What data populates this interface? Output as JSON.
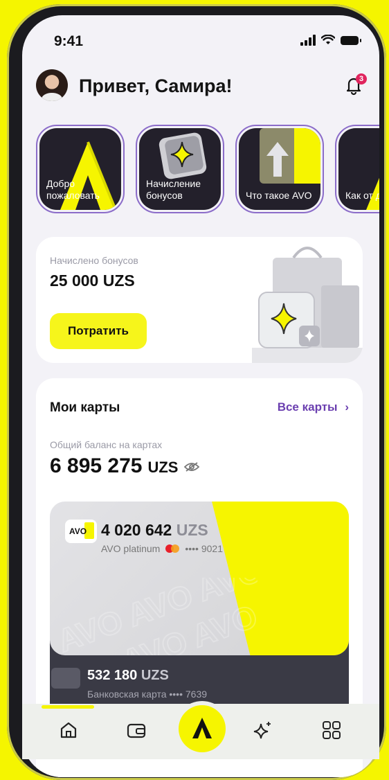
{
  "status": {
    "time": "9:41"
  },
  "header": {
    "greeting": "Привет, Самира!",
    "notifications_count": "3"
  },
  "stories": [
    {
      "label": "Добро пожаловать"
    },
    {
      "label": "Начисление бонусов"
    },
    {
      "label": "Что такое AVO"
    },
    {
      "label": "Как от депози"
    }
  ],
  "bonus": {
    "caption": "Начислено бонусов",
    "value": "25 000 UZS",
    "button_label": "Потратить"
  },
  "cards": {
    "title": "Мои карты",
    "all_label": "Все карты",
    "balance_caption": "Общий баланс на картах",
    "balance_value": "6 895 275",
    "balance_currency": "UZS",
    "items": [
      {
        "logo": "AVO",
        "amount": "4 020 642",
        "currency": "UZS",
        "name": "AVO platinum",
        "number": "•••• 9021"
      },
      {
        "amount": "532 180",
        "currency": "UZS",
        "name": "Банковская карта",
        "number": "•••• 7639"
      }
    ]
  },
  "tabbar": {
    "icons": [
      "home-icon",
      "wallet-icon",
      "avo-logo-icon",
      "sparkle-icon",
      "grid-icon"
    ]
  },
  "colors": {
    "accent": "#f6f500",
    "purple": "#6b3fb0",
    "dark": "#23202b"
  }
}
